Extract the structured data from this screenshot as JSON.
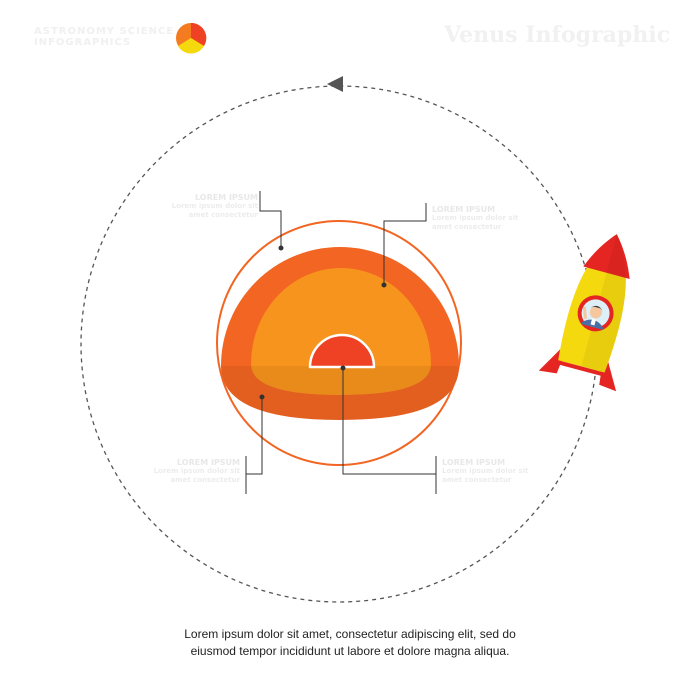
{
  "brand": {
    "line1": "ASTRONOMY SCIENCE",
    "line2": "INFOGRAPHICS"
  },
  "title": "Venus Infographic",
  "labels": {
    "top_left": {
      "title": "LOREM IPSUM",
      "text": "Lorem ipsum dolor sit amet consectetur"
    },
    "top_right": {
      "title": "LOREM IPSUM",
      "text": "Lorem ipsum dolor sit amet consectetur"
    },
    "bottom_left": {
      "title": "LOREM IPSUM",
      "text": "Lorem ipsum dolor sit amet consectetur"
    },
    "bottom_right": {
      "title": "LOREM IPSUM",
      "text": "Lorem ipsum dolor sit amet consectetur"
    }
  },
  "caption": {
    "line1": "Lorem ipsum dolor sit amet, consectetur adipiscing elit, sed do",
    "line2": "eiusmod tempor incididunt ut labore et dolore magna aliqua."
  },
  "colors": {
    "outer_layer": "#F26522",
    "mid_layer": "#F47B20",
    "inner_layer": "#F7941D",
    "core": "#EF4123",
    "rocket_body": "#F5D90F",
    "rocket_fin": "#E52521",
    "orbit": "#555555"
  },
  "icons": [
    "pie-chart-logo-icon",
    "orbit-arrow-icon",
    "rocket-icon",
    "astronaut-icon"
  ]
}
